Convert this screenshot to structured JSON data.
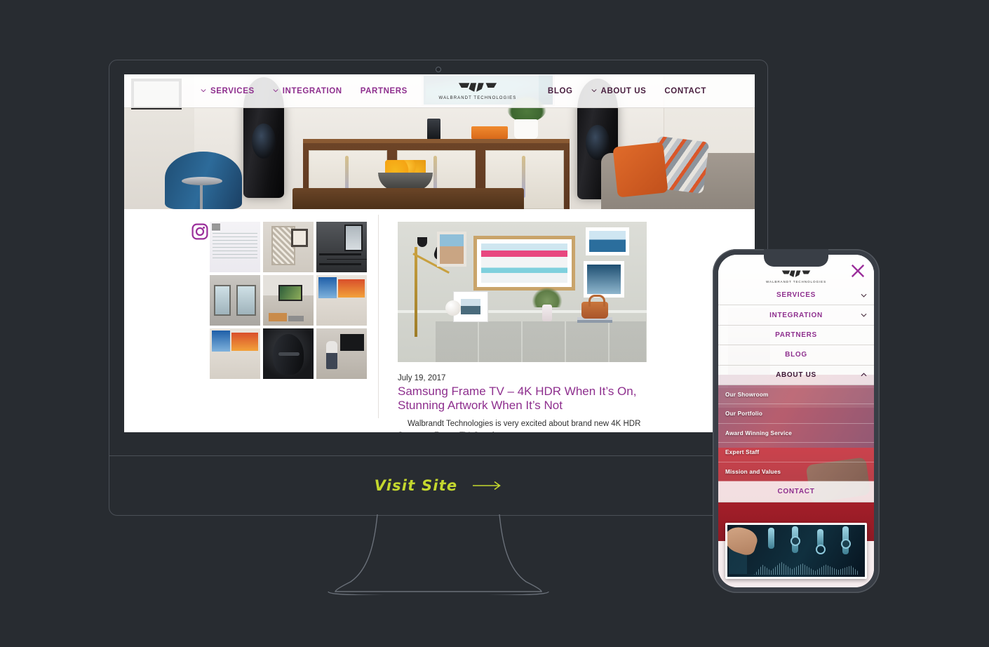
{
  "theme": {
    "background": "#282c31",
    "accent_purple": "#8e2f8e",
    "accent_yellow_green": "#c4d82e",
    "frame_gray": "#4b5057"
  },
  "desktop": {
    "site_nav": {
      "logo_text": "WALBRANDT TECHNOLOGIES",
      "items": [
        {
          "label": "SERVICES",
          "has_caret": true,
          "dark": false
        },
        {
          "label": "INTEGRATION",
          "has_caret": true,
          "dark": false
        },
        {
          "label": "PARTNERS",
          "has_caret": false,
          "dark": false
        },
        {
          "label": "BLOG",
          "has_caret": false,
          "dark": true
        },
        {
          "label": "ABOUT US",
          "has_caret": true,
          "dark": true
        },
        {
          "label": "CONTACT",
          "has_caret": false,
          "dark": true
        }
      ]
    },
    "instagram": {
      "icon": "instagram-icon",
      "cells": [
        "ig-post-apple-ios-update",
        "ig-post-cabinet-interior",
        "ig-post-construction-window",
        "ig-post-email-screenshot",
        "ig-post-hallway-doors",
        "ig-post-tv-install-ceiling",
        "ig-post-kitchen-flyer",
        "ig-post-black-speaker",
        "ig-post-technician-tv"
      ]
    },
    "blog": {
      "date": "July 19, 2017",
      "title": "Samsung Frame TV – 4K HDR When It’s On, Stunning Artwork When It’s Not",
      "excerpt": "Walbrandt Technologies is very excited about brand new 4K HDR Samsung Frame TV.   Stop by our",
      "image_alt": "samsung-frame-tv-gallery-wall"
    },
    "hero_image_alt": "living-room-with-tv-and-speakers"
  },
  "visit_site": {
    "label": "Visit Site",
    "arrow_icon": "arrow-right-icon"
  },
  "phone": {
    "logo_text": "WALBRANDT TECHNOLOGIES",
    "close_icon": "close-icon",
    "menu": [
      {
        "label": "SERVICES",
        "chevron": "chevron-down-icon",
        "expanded": false
      },
      {
        "label": "INTEGRATION",
        "chevron": "chevron-down-icon",
        "expanded": false
      },
      {
        "label": "PARTNERS",
        "chevron": "",
        "expanded": false
      },
      {
        "label": "BLOG",
        "chevron": "",
        "expanded": false
      },
      {
        "label": "ABOUT US",
        "chevron": "chevron-up-icon",
        "expanded": true
      }
    ],
    "submenu": [
      "Our Showroom",
      "Our Portfolio",
      "Award Winning Service",
      "Expert Staff",
      "Mission and Values"
    ],
    "contact_label": "CONTACT",
    "bottom_image_alt": "touchscreen-control-panel"
  }
}
